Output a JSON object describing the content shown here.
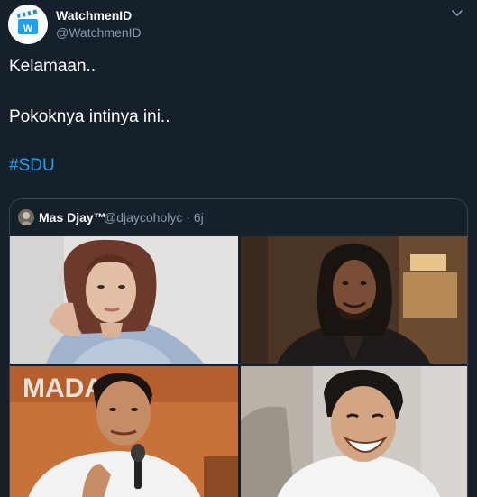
{
  "author": {
    "name": "WatchmenID",
    "handle": "@WatchmenID",
    "avatar_icon": "clapperboard-w-icon",
    "avatar_color": "#1da1f2"
  },
  "tweet": {
    "line1": "Kelamaan..",
    "line2": "Pokoknya intinya ini..",
    "hashtag": "#SDU"
  },
  "quoted": {
    "name": "Mas Djay™",
    "handle": "@djaycoholyc",
    "time": "6j",
    "photo_sign": "MADA"
  },
  "colors": {
    "background": "#15202b",
    "secondary_text": "#8899a6",
    "link": "#1da1f2",
    "border": "#38444d"
  }
}
